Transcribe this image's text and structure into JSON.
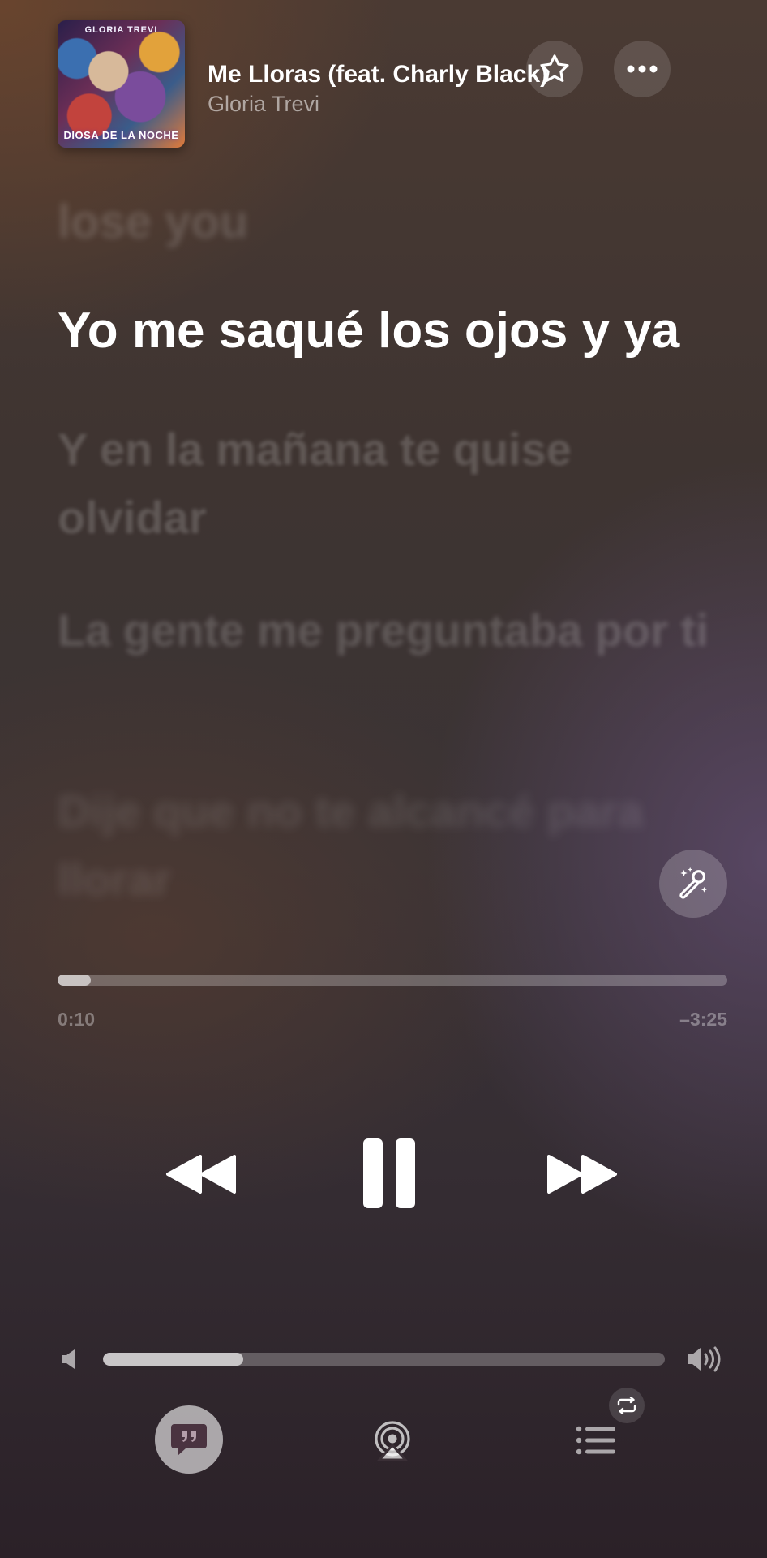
{
  "now_playing": {
    "album_art_text_top": "GLORIA TREVI",
    "album_art_text_bottom": "DIOSA DE LA NOCHE",
    "song_title": "Me Lloras (feat. Charly Black)",
    "artist": "Gloria Trevi"
  },
  "lyrics": {
    "previous_partial": "",
    "previous": "lose you",
    "current": "Yo me saqué los ojos y ya",
    "next": [
      "Y en la mañana te quise olvidar",
      "La gente me preguntaba por ti",
      "Dije que no te alcancé para llorar"
    ]
  },
  "progress": {
    "elapsed": "0:10",
    "remaining": "–3:25",
    "fraction": 0.05
  },
  "volume": {
    "fraction": 0.25
  },
  "icons": {
    "favorite": "star-icon",
    "more": "ellipsis-icon",
    "sing": "microphone-sparkles-icon",
    "rewind": "rewind-icon",
    "pause": "pause-icon",
    "forward": "fast-forward-icon",
    "volume_low": "speaker-icon",
    "volume_high": "speaker-wave-icon",
    "lyrics": "quote-bubble-icon",
    "airplay": "airplay-audio-icon",
    "queue": "list-icon",
    "repeat": "repeat-icon"
  },
  "colors": {
    "lyrics_button_background": "#b59eaa",
    "lyrics_button_glyph": "#4a3340"
  }
}
